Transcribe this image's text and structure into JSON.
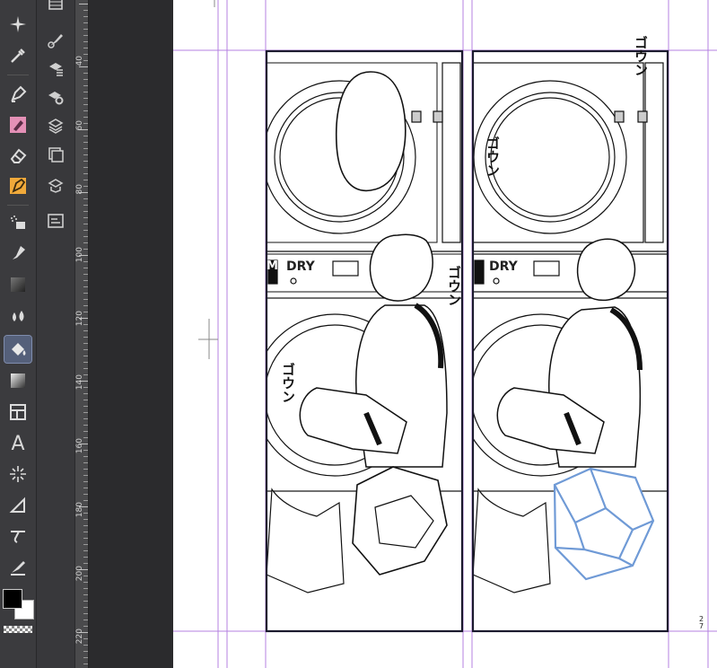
{
  "tools": {
    "items": [
      {
        "id": "auto-action",
        "icon": "sparkle-icon"
      },
      {
        "id": "eyedropper",
        "icon": "eyedropper-icon"
      },
      {
        "id": "pen",
        "icon": "pen-nib-icon"
      },
      {
        "id": "pencil",
        "icon": "pencil-icon"
      },
      {
        "id": "eraser",
        "icon": "eraser-icon"
      },
      {
        "id": "vector-pen",
        "icon": "vector-pen-icon"
      },
      {
        "id": "airbrush",
        "icon": "airbrush-icon"
      },
      {
        "id": "brush",
        "icon": "brush-icon"
      },
      {
        "id": "decoration",
        "icon": "decoration-icon"
      },
      {
        "id": "blend",
        "icon": "blend-drops-icon"
      },
      {
        "id": "fill",
        "icon": "fill-bucket-icon",
        "active": true
      },
      {
        "id": "gradient",
        "icon": "gradient-icon"
      },
      {
        "id": "frame-border",
        "icon": "frame-border-icon"
      },
      {
        "id": "text",
        "icon": "text-icon",
        "label": "A"
      },
      {
        "id": "figure",
        "icon": "ruler-lines-icon"
      },
      {
        "id": "line-correction",
        "icon": "line-correction-icon"
      },
      {
        "id": "balloon",
        "icon": "balloon-icon"
      },
      {
        "id": "correct-line",
        "icon": "correct-line-icon"
      }
    ]
  },
  "subtools": {
    "items": [
      {
        "id": "animation",
        "icon": "film-icon"
      },
      {
        "id": "brush-size",
        "icon": "brush-size-icon"
      },
      {
        "id": "layer-property",
        "icon": "layer-property-icon"
      },
      {
        "id": "layer-settings",
        "icon": "layer-gear-icon"
      },
      {
        "id": "layers",
        "icon": "layers-icon"
      },
      {
        "id": "navigator",
        "icon": "navigator-icon"
      },
      {
        "id": "material",
        "icon": "material-icon"
      },
      {
        "id": "tool-property",
        "icon": "tool-property-icon"
      }
    ]
  },
  "ruler": {
    "labels": [
      "40",
      "60",
      "80",
      "100",
      "120",
      "140",
      "160",
      "180",
      "200",
      "220"
    ]
  },
  "colors": {
    "main": "#000000",
    "sub": "#ffffff",
    "accent_active": "#55607a",
    "guide": "#b480e0",
    "sketch_blue": "#6f9ad6"
  },
  "canvas": {
    "page_number": "27",
    "sfx": {
      "left_panel": "ゴウン",
      "top_right": "ゴウン",
      "right_panel_upper": "ゴウン",
      "middle": "ゴウン"
    },
    "machine_labels": {
      "left": "DRY",
      "right": "DRY",
      "left_edge": "M"
    }
  }
}
